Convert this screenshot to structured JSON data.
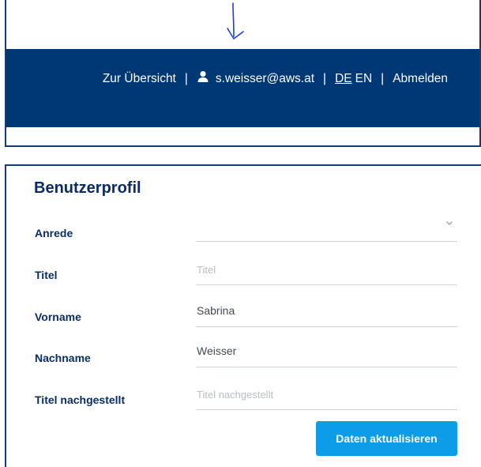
{
  "header": {
    "overview_link": "Zur Übersicht",
    "separator": "|",
    "user_email": "s.weisser@aws.at",
    "lang_de": "DE",
    "lang_en": "EN",
    "logout": "Abmelden",
    "colors": {
      "bar": "#003876",
      "text": "#ffffff"
    },
    "user_icon": "user-icon"
  },
  "annotation": {
    "icon": "arrow-down-icon",
    "color": "#1f3fd6"
  },
  "profile": {
    "title": "Benutzerprofil",
    "fields": [
      {
        "label": "Anrede",
        "value": "",
        "placeholder": "",
        "type": "select"
      },
      {
        "label": "Titel",
        "value": "",
        "placeholder": "Titel",
        "type": "text"
      },
      {
        "label": "Vorname",
        "value": "Sabrina",
        "placeholder": "",
        "type": "text"
      },
      {
        "label": "Nachname",
        "value": "Weisser",
        "placeholder": "",
        "type": "text"
      },
      {
        "label": "Titel nachgestellt",
        "value": "",
        "placeholder": "Titel nachgestellt",
        "type": "text"
      }
    ],
    "submit_label": "Daten aktualisieren",
    "colors": {
      "heading": "#0b2d63",
      "button": "#0d9ce8"
    }
  }
}
